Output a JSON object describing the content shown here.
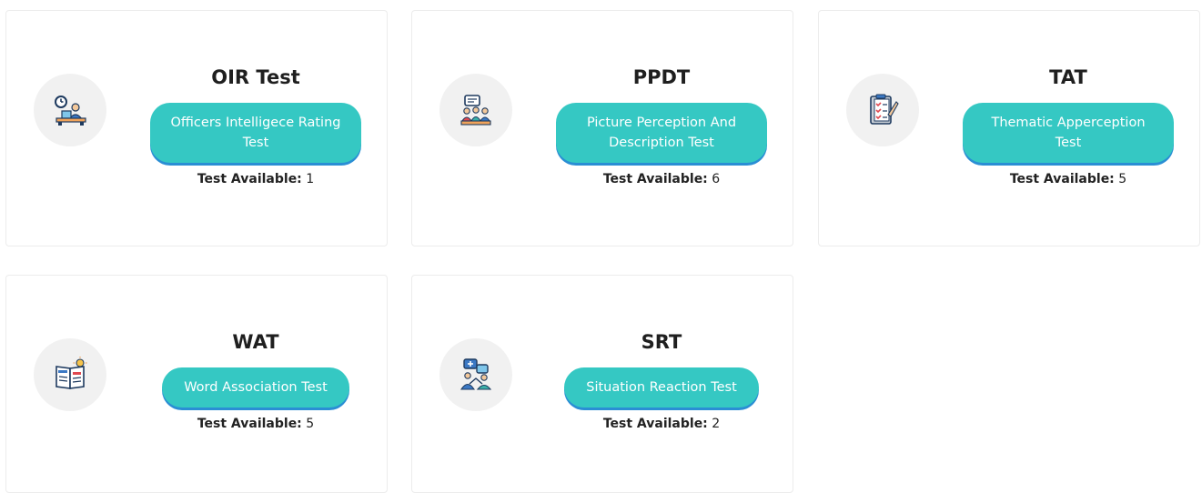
{
  "cards": [
    {
      "title": "OIR Test",
      "button_label": "Officers Intelligece Rating Test",
      "available_label": "Test Available:",
      "available_count": "1",
      "icon": "officer-desk-icon"
    },
    {
      "title": "PPDT",
      "button_label": "Picture Perception And Description Test",
      "available_label": "Test Available:",
      "available_count": "6",
      "icon": "group-discussion-icon"
    },
    {
      "title": "TAT",
      "button_label": "Thematic Apperception Test",
      "available_label": "Test Available:",
      "available_count": "5",
      "icon": "clipboard-checklist-icon"
    },
    {
      "title": "WAT",
      "button_label": "Word Association Test",
      "available_label": "Test Available:",
      "available_count": "5",
      "icon": "book-idea-icon"
    },
    {
      "title": "SRT",
      "button_label": "Situation Reaction Test",
      "available_label": "Test Available:",
      "available_count": "2",
      "icon": "people-reaction-icon"
    }
  ],
  "colors": {
    "button_bg": "#35c8c3",
    "button_shadow": "#2a8ed4",
    "icon_circle_bg": "#f1f1f1",
    "card_border": "#ececec"
  }
}
